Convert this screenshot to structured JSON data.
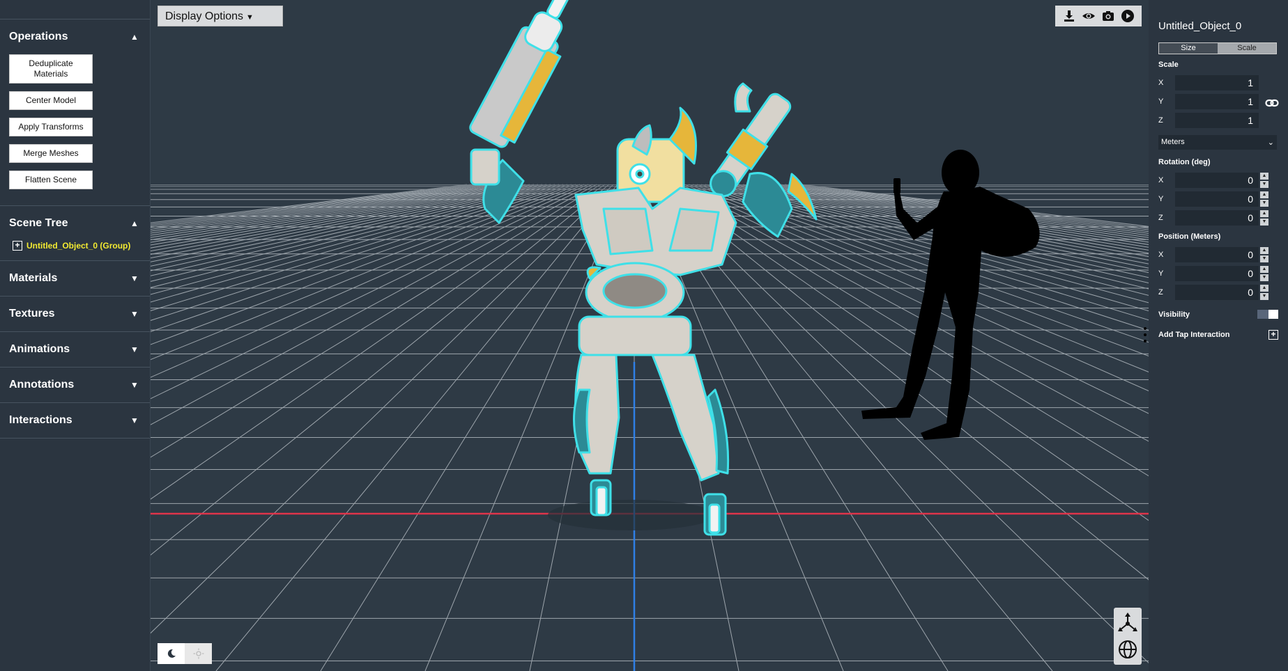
{
  "sidebar": {
    "operations": {
      "title": "Operations",
      "buttons": [
        "Deduplicate Materials",
        "Center Model",
        "Apply Transforms",
        "Merge Meshes",
        "Flatten Scene"
      ]
    },
    "scene_tree": {
      "title": "Scene Tree",
      "item": "Untitled_Object_0 (Group)"
    },
    "sections": [
      "Materials",
      "Textures",
      "Animations",
      "Annotations",
      "Interactions"
    ]
  },
  "viewport": {
    "display_options_label": "Display Options",
    "toolbar_icons": [
      "download-icon",
      "eye-icon",
      "camera-icon",
      "play-icon"
    ],
    "theme_icons": [
      "moon-icon",
      "sun-icon"
    ],
    "nav_icons": [
      "axes-gizmo-icon",
      "orbit-globe-icon"
    ],
    "colors": {
      "background": "#2e3a45",
      "x_axis": "#e0344a",
      "y_axis": "#2f7fe6",
      "outline": "#3fe0e8"
    }
  },
  "right_panel": {
    "title": "Untitled_Object_0",
    "tabs": {
      "size": "Size",
      "scale": "Scale"
    },
    "scale": {
      "label": "Scale",
      "x_label": "X",
      "x": "1",
      "y_label": "Y",
      "y": "1",
      "z_label": "Z",
      "z": "1"
    },
    "units": "Meters",
    "rotation": {
      "label": "Rotation (deg)",
      "x_label": "X",
      "x": "0",
      "y_label": "Y",
      "y": "0",
      "z_label": "Z",
      "z": "0"
    },
    "position": {
      "label": "Position (Meters)",
      "x_label": "X",
      "x": "0",
      "y_label": "Y",
      "y": "0",
      "z_label": "Z",
      "z": "0"
    },
    "visibility_label": "Visibility",
    "visibility_on": true,
    "add_tap_label": "Add Tap Interaction"
  }
}
